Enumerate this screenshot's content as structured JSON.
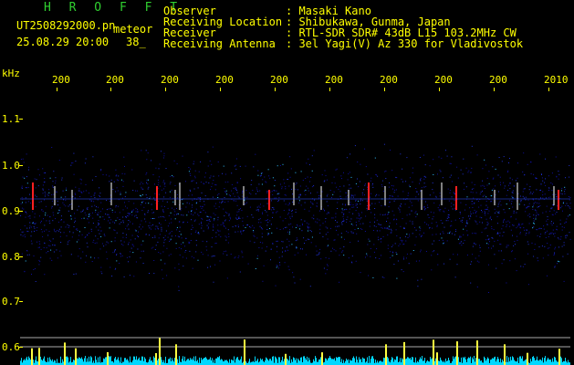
{
  "header": {
    "station": "H R O F F T",
    "filename": "UT2508292000.pn",
    "mode": "meteor",
    "datetime": "25.08.29 20:00",
    "count": "38_",
    "fields": [
      {
        "label": "Observer",
        "value": ": Masaki Kano"
      },
      {
        "label": "Receiving Location",
        "value": ": Shibukawa, Gunma, Japan"
      },
      {
        "label": "Receiver",
        "value": ": RTL-SDR SDR# 43dB L15 103.2MHz CW"
      },
      {
        "label": "Receiving Antenna",
        "value": ": 3el Yagi(V) Az 330 for Vladivostok"
      }
    ]
  },
  "axes": {
    "y_unit": "kHz",
    "y_ticks": [
      "1.1",
      "1.0",
      "0.9",
      "0.8",
      "0.7",
      "0.6"
    ],
    "x_ticks": [
      "200",
      "200",
      "200",
      "200",
      "200",
      "200",
      "200",
      "200",
      "200",
      "2010"
    ]
  },
  "colors": {
    "text": "#ffff00",
    "station": "#30d030",
    "signal_low": "#1010a0",
    "signal_mid": "#30c0ff",
    "signal_high": "#ff2020",
    "meter": "#00d8ff"
  }
}
